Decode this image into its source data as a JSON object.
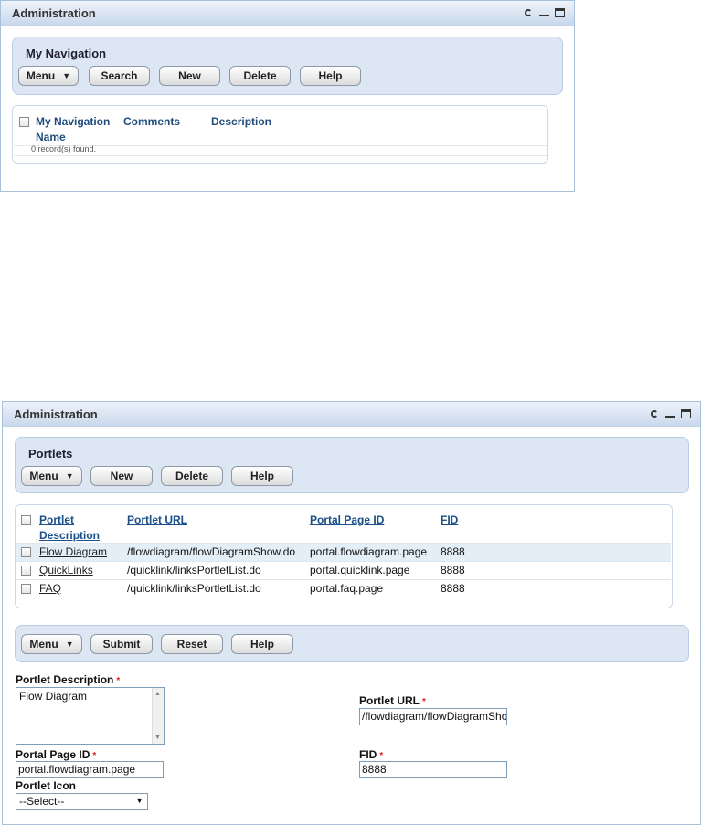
{
  "top_portlet": {
    "title": "Administration",
    "nav_box": {
      "title": "My Navigation",
      "buttons": [
        "Menu",
        "Search",
        "New",
        "Delete",
        "Help"
      ]
    },
    "grid": {
      "columns": [
        "My Navigation",
        "Comments",
        "Description"
      ],
      "column_second_line": "Name",
      "status": "0 record(s) found."
    }
  },
  "bottom_portlet": {
    "title": "Administration",
    "portlets_box": {
      "title": "Portlets",
      "buttons": [
        "Menu",
        "New",
        "Delete",
        "Help"
      ]
    },
    "grid": {
      "columns": [
        "Portlet",
        "Portlet URL",
        "Portal Page ID",
        "FID"
      ],
      "column_second_line": "Description",
      "rows": [
        {
          "description": "Flow Diagram",
          "url": "/flowdiagram/flowDiagramShow.do",
          "page_id": "portal.flowdiagram.page",
          "fid": "8888"
        },
        {
          "description": "QuickLinks",
          "url": "/quicklink/linksPortletList.do",
          "page_id": "portal.quicklink.page",
          "fid": "8888"
        },
        {
          "description": "FAQ",
          "url": "/quicklink/linksPortletList.do",
          "page_id": "portal.faq.page",
          "fid": "8888"
        }
      ]
    },
    "form_toolbar": {
      "buttons": [
        "Menu",
        "Submit",
        "Reset",
        "Help"
      ]
    },
    "form": {
      "description_label": "Portlet Description",
      "description_value": "Flow Diagram",
      "url_label": "Portlet URL",
      "url_value": "/flowdiagram/flowDiagramShow",
      "page_id_label": "Portal Page ID",
      "page_id_value": "portal.flowdiagram.page",
      "fid_label": "FID",
      "fid_value": "8888",
      "icon_label": "Portlet Icon",
      "icon_selected": "--Select--",
      "required_mark": "*"
    }
  },
  "colors": {
    "accent": "#1a4f8a",
    "required": "#dd2222",
    "box_bg": "#dde7f4",
    "selected_row": "#e4eef6"
  },
  "icons": [
    "refresh-icon",
    "minimize-icon",
    "maximize-icon",
    "menu-dropdown-icon",
    "select-dropdown-icon"
  ]
}
